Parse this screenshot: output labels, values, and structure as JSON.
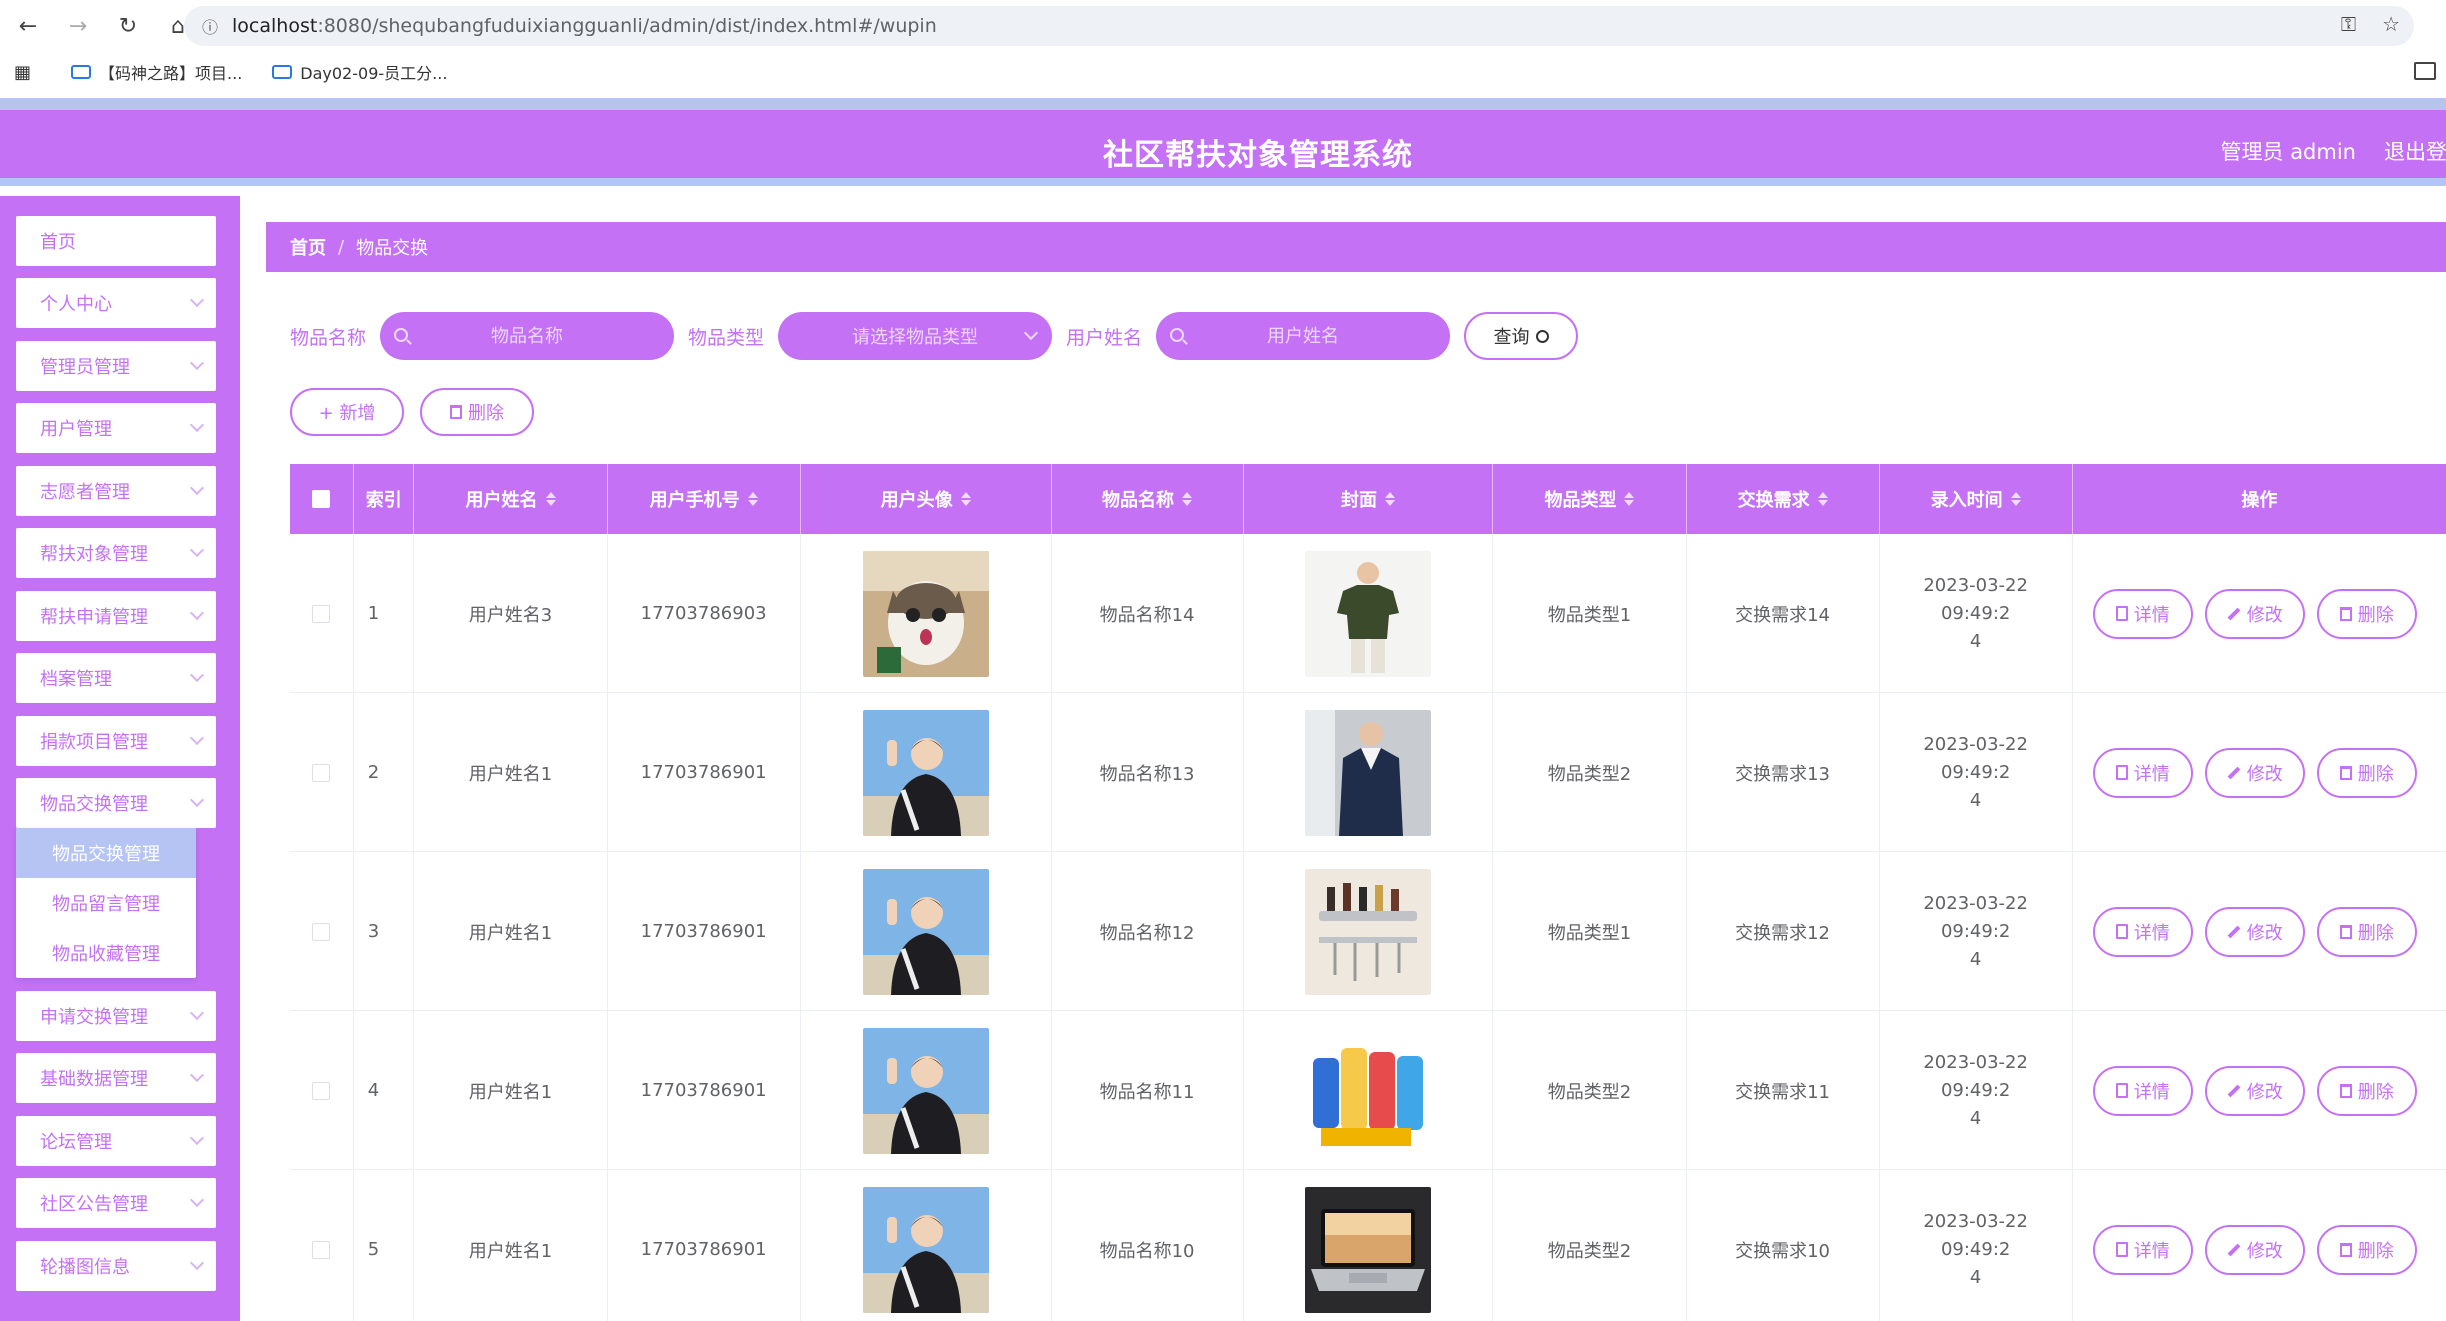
{
  "browser": {
    "url_host": "localhost",
    "url_rest": ":8080/shequbangfuduixiangguanli/admin/dist/index.html#/wupin",
    "bookmarks": [
      "【码神之路】项目...",
      "Day02-09-员工分..."
    ]
  },
  "header": {
    "title": "社区帮扶对象管理系统",
    "user": "管理员 admin",
    "logout": "退出登录"
  },
  "sidebar": {
    "items": [
      {
        "label": "首页"
      },
      {
        "label": "个人中心"
      },
      {
        "label": "管理员管理"
      },
      {
        "label": "用户管理"
      },
      {
        "label": "志愿者管理"
      },
      {
        "label": "帮扶对象管理"
      },
      {
        "label": "帮扶申请管理"
      },
      {
        "label": "档案管理"
      },
      {
        "label": "捐款项目管理"
      },
      {
        "label": "物品交换管理"
      },
      {
        "label": "申请交换管理"
      },
      {
        "label": "基础数据管理"
      },
      {
        "label": "论坛管理"
      },
      {
        "label": "社区公告管理"
      },
      {
        "label": "轮播图信息"
      }
    ],
    "submenu": [
      {
        "label": "物品交换管理"
      },
      {
        "label": "物品留言管理"
      },
      {
        "label": "物品收藏管理"
      }
    ]
  },
  "breadcrumb": {
    "home": "首页",
    "separator": "/",
    "current": "物品交换"
  },
  "filters": {
    "name_label": "物品名称",
    "name_placeholder": "物品名称",
    "type_label": "物品类型",
    "type_placeholder": "请选择物品类型",
    "user_label": "用户姓名",
    "user_placeholder": "用户姓名",
    "query_label": "查询"
  },
  "actions": {
    "add_label": "+ 新增",
    "delete_label": "删除"
  },
  "table": {
    "columns": [
      "索引",
      "用户姓名",
      "用户手机号",
      "用户头像",
      "物品名称",
      "封面",
      "物品类型",
      "交换需求",
      "录入时间",
      "操作"
    ],
    "row_buttons": {
      "detail": "详情",
      "edit": "修改",
      "delete": "删除"
    },
    "rows": [
      {
        "index": "1",
        "user": "用户姓名3",
        "phone": "17703786903",
        "avatar": "cat",
        "item": "物品名称14",
        "cover": "tshirt",
        "type": "物品类型1",
        "need": "交换需求14",
        "time1": "2023-03-22 09:49:2",
        "time2": "4"
      },
      {
        "index": "2",
        "user": "用户姓名1",
        "phone": "17703786901",
        "avatar": "person",
        "item": "物品名称13",
        "cover": "jacket",
        "type": "物品类型2",
        "need": "交换需求13",
        "time1": "2023-03-22 09:49:2",
        "time2": "4"
      },
      {
        "index": "3",
        "user": "用户姓名1",
        "phone": "17703786901",
        "avatar": "person",
        "item": "物品名称12",
        "cover": "rack",
        "type": "物品类型1",
        "need": "交换需求12",
        "time1": "2023-03-22 09:49:2",
        "time2": "4"
      },
      {
        "index": "4",
        "user": "用户姓名1",
        "phone": "17703786901",
        "avatar": "person",
        "item": "物品名称11",
        "cover": "bottles",
        "type": "物品类型2",
        "need": "交换需求11",
        "time1": "2023-03-22 09:49:2",
        "time2": "4"
      },
      {
        "index": "5",
        "user": "用户姓名1",
        "phone": "17703786901",
        "avatar": "person",
        "item": "物品名称10",
        "cover": "laptop",
        "type": "物品类型2",
        "need": "交换需求10",
        "time1": "2023-03-22 09:49:2",
        "time2": "4"
      }
    ]
  },
  "colors": {
    "primary": "#c471f5",
    "accent": "#b6c4f3"
  }
}
